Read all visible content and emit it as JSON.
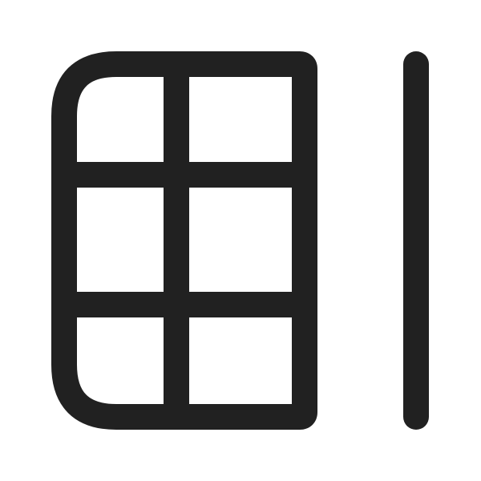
{
  "icon": {
    "name": "table-freeze-column-icon",
    "stroke_color": "#212121",
    "background_color": "#ffffff"
  }
}
